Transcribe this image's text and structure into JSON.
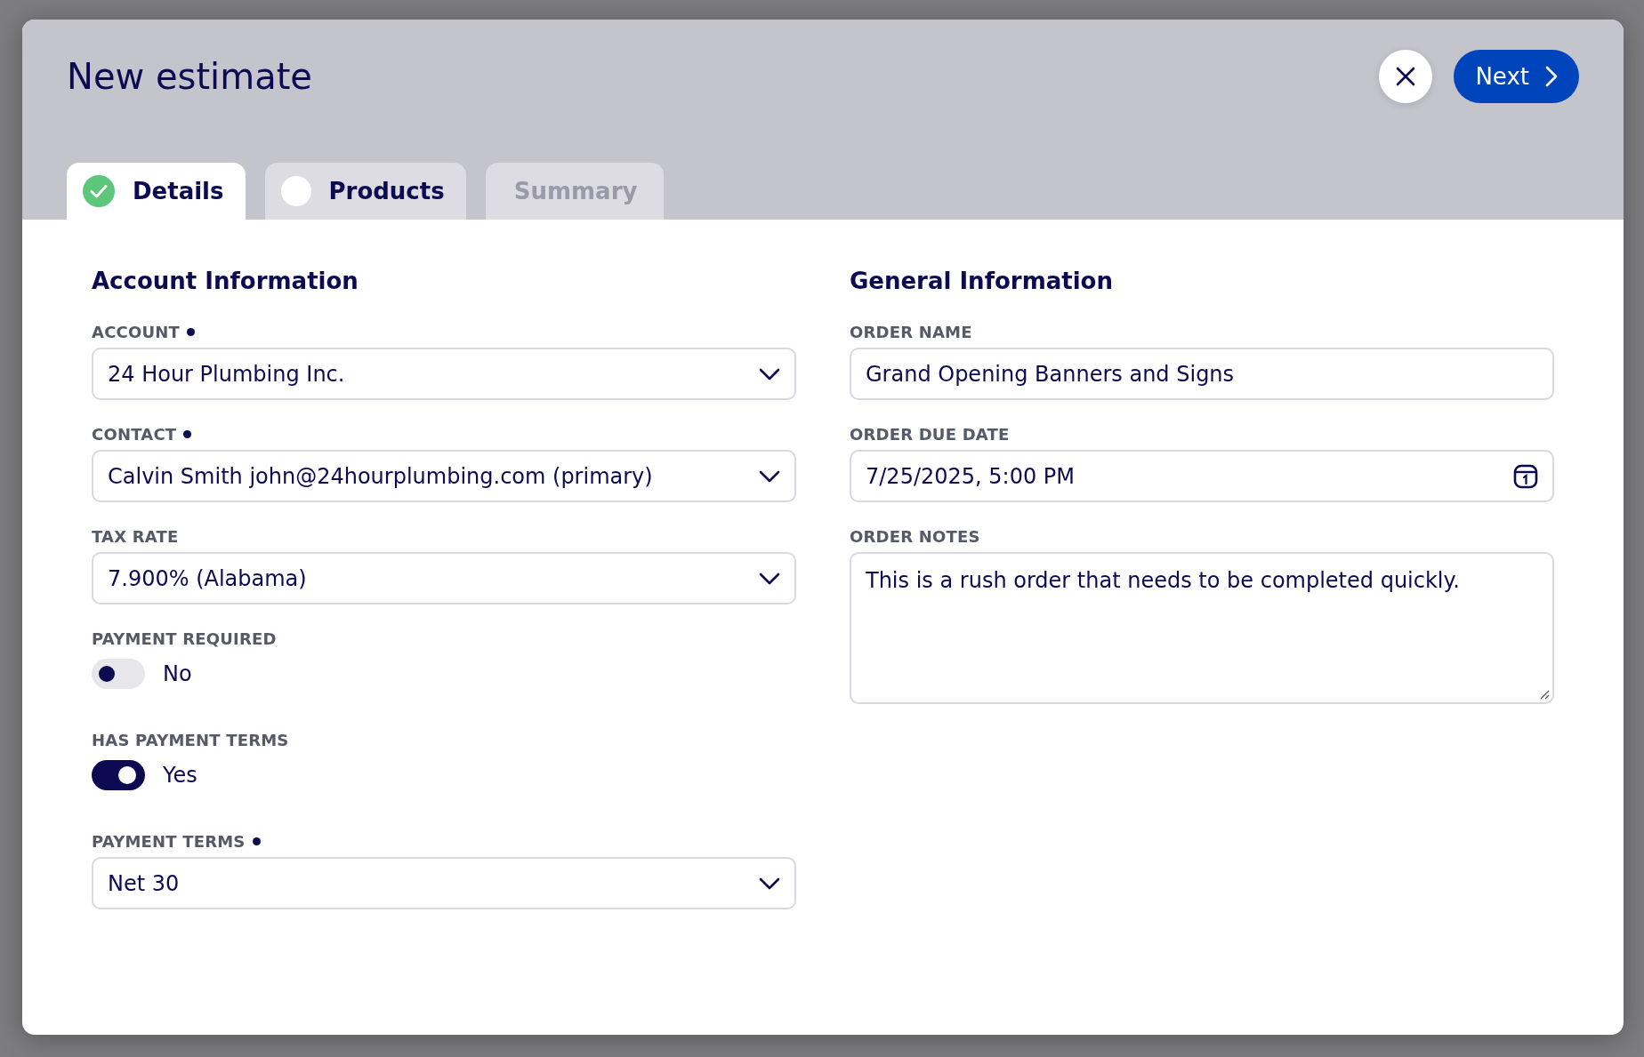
{
  "dialog": {
    "title": "New estimate",
    "next_button": "Next"
  },
  "tabs": [
    {
      "label": "Details",
      "selected": true,
      "kind": "done",
      "disabled": false
    },
    {
      "label": "Products",
      "selected": false,
      "kind": "pending",
      "disabled": false
    },
    {
      "label": "Summary",
      "selected": false,
      "kind": "plain",
      "disabled": true
    }
  ],
  "sections": [
    {
      "title": "Account Information",
      "fields": [
        {
          "kind": "select",
          "label": "ACCOUNT",
          "required": true,
          "value": "24 Hour Plumbing Inc."
        },
        {
          "kind": "select",
          "label": "CONTACT",
          "required": true,
          "value": "Calvin Smith john@24hourplumbing.com (primary)"
        },
        {
          "kind": "select",
          "label": "TAX RATE",
          "required": false,
          "value": "7.900% (Alabama)"
        },
        {
          "kind": "toggle",
          "label": "PAYMENT REQUIRED",
          "required": false,
          "on": false,
          "value": "No"
        },
        {
          "kind": "toggle",
          "label": "HAS PAYMENT TERMS",
          "required": false,
          "on": true,
          "value": "Yes"
        },
        {
          "kind": "select",
          "label": "PAYMENT TERMS",
          "required": true,
          "value": "Net 30"
        }
      ]
    },
    {
      "title": "General Information",
      "fields": [
        {
          "kind": "text",
          "label": "ORDER NAME",
          "required": false,
          "value": "Grand Opening Banners and Signs"
        },
        {
          "kind": "date",
          "label": "ORDER DUE DATE",
          "required": false,
          "value": "7/25/2025, 5:00 PM"
        },
        {
          "kind": "textarea",
          "label": "ORDER NOTES",
          "required": false,
          "value": "This is a rush order that needs to be completed quickly."
        }
      ]
    }
  ]
}
